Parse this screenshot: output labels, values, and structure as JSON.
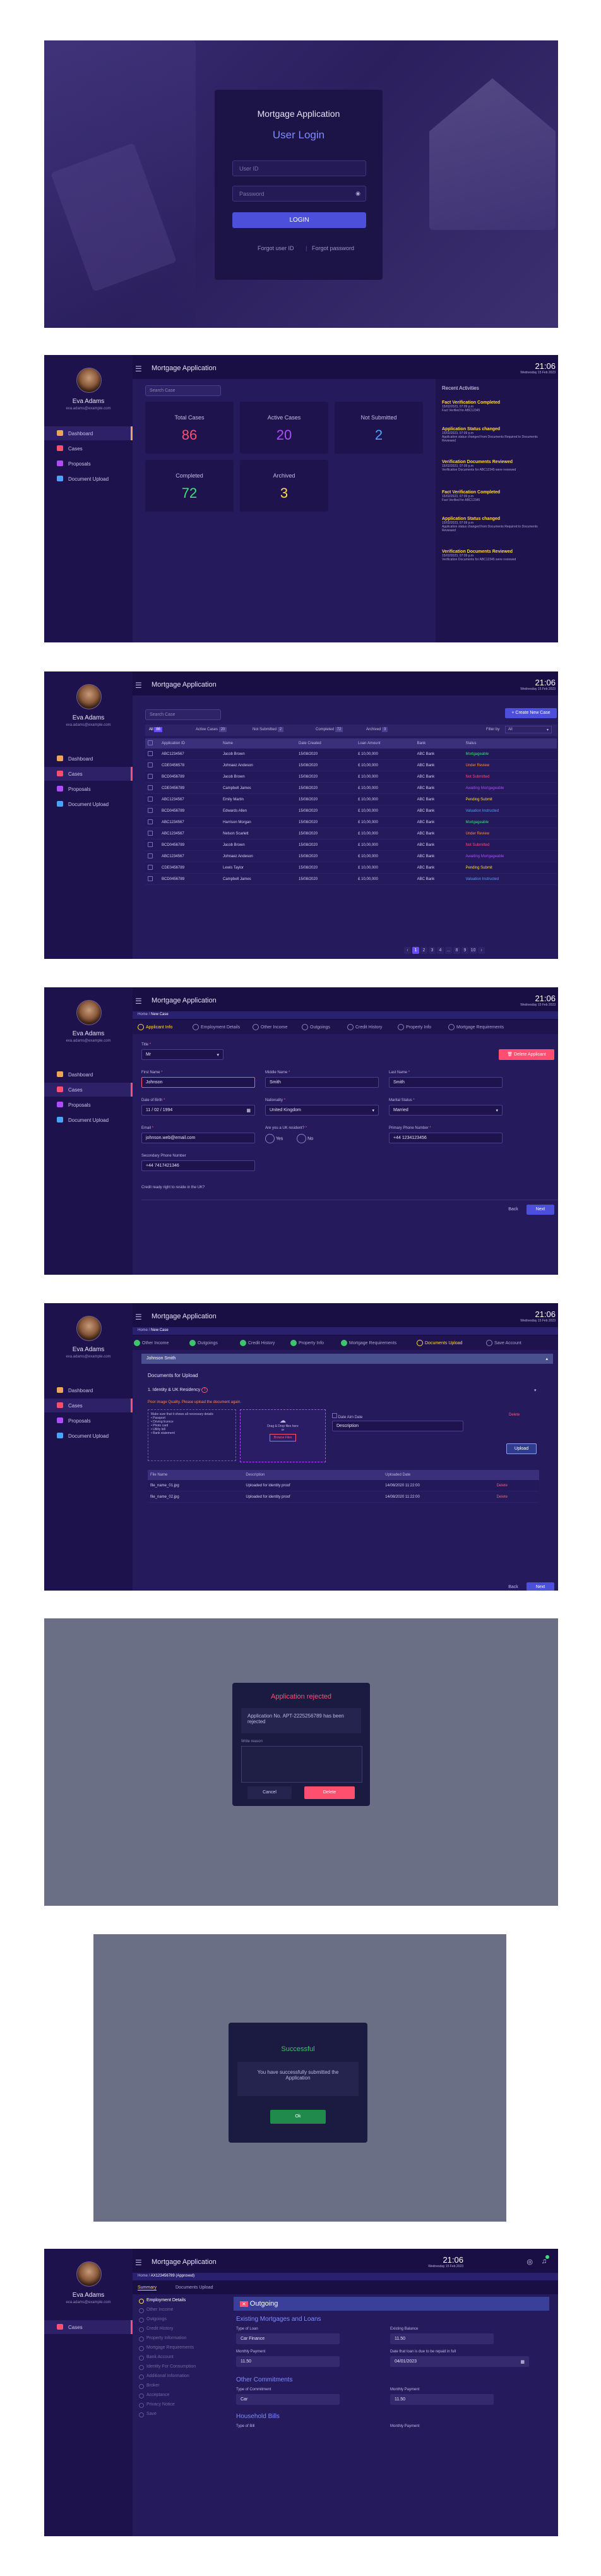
{
  "app_title": "Mortgage Application",
  "login": {
    "heading": "Mortgage Application",
    "subheading": "User Login",
    "user_placeholder": "User ID",
    "password_placeholder": "Password",
    "button": "LOGIN",
    "forgot": "Forgot user ID",
    "forgot_password": "Forgot password"
  },
  "user": {
    "name": "Eva Adams",
    "email": "eva.adams@example.com"
  },
  "clock": {
    "time": "21:06",
    "date": "Wednesday 15 Feb 2023"
  },
  "nav": {
    "dashboard": "Dashboard",
    "cases": "Cases",
    "proposals": "Proposals",
    "document_upload": "Document Upload"
  },
  "dashboard": {
    "search_placeholder": "Search Case",
    "cards": [
      {
        "label": "Total Cases",
        "value": "86",
        "color": "#ff4f6e"
      },
      {
        "label": "Active Cases",
        "value": "20",
        "color": "#b04bff"
      },
      {
        "label": "Not Submitted",
        "value": "2",
        "color": "#4ea2ff"
      },
      {
        "label": "Completed",
        "value": "72",
        "color": "#3ee07a"
      },
      {
        "label": "Archived",
        "value": "3",
        "color": "#ffd94a"
      }
    ],
    "activities_title": "Recent Activities",
    "activities": [
      {
        "title": "Fact Verification Completed",
        "time": "15/02/2023, 07:09 p.m",
        "desc": "Fact Verified for ABC12345"
      },
      {
        "title": "Application Status changed",
        "time": "15/02/2023, 07:09 p.m",
        "desc": "Application status changed from Documents Required to Documents Reviewed"
      },
      {
        "title": "Verification Documents Reviewed",
        "time": "15/02/2023, 07:09 p.m",
        "desc": "Verification Documents for ABC12345 were reviewed"
      },
      {
        "title": "Fact Verification Completed",
        "time": "15/02/2023, 07:09 p.m",
        "desc": "Fact Verified for ABC12345"
      },
      {
        "title": "Application Status changed",
        "time": "15/02/2023, 07:09 p.m",
        "desc": "Application status changed from Documents Required to Documents Reviewed"
      },
      {
        "title": "Verification Documents Reviewed",
        "time": "15/02/2023, 07:09 p.m",
        "desc": "Verification Documents for ABC12345 were reviewed"
      }
    ]
  },
  "cases": {
    "create_button": "+ Create New Case",
    "filter_label": "Filter by",
    "filter_value": "All",
    "tabs": [
      {
        "label": "All",
        "count": "86"
      },
      {
        "label": "Active Cases",
        "count": "20"
      },
      {
        "label": "Not Submitted",
        "count": "2"
      },
      {
        "label": "Completed",
        "count": "72"
      },
      {
        "label": "Archived",
        "count": "3"
      }
    ],
    "columns": [
      "Application ID",
      "Name",
      "Date Created",
      "Loan Amount",
      "Bank",
      "Status"
    ],
    "rows": [
      [
        "ABC1234567",
        "Jacob Brown",
        "15/08/2020",
        "£ 10,00,000",
        "ABC Bank",
        "Mortgageable"
      ],
      [
        "CDE0456578",
        "Johnaez Andeson",
        "15/08/2020",
        "£ 10,00,000",
        "ABC Bank",
        "Under Review"
      ],
      [
        "BCD0456789",
        "Jacob Brown",
        "15/08/2020",
        "£ 10,00,000",
        "ABC Bank",
        "Not Submitted"
      ],
      [
        "CDE0456789",
        "Campbell James",
        "15/08/2020",
        "£ 10,00,000",
        "ABC Bank",
        "Awaiting Mortgageable"
      ],
      [
        "ABC1234567",
        "Emily Martin",
        "15/08/2020",
        "£ 10,00,000",
        "ABC Bank",
        "Pending Submit"
      ],
      [
        "BCD0456789",
        "Edwards Allen",
        "15/08/2020",
        "£ 10,00,000",
        "ABC Bank",
        "Valuation Instructed"
      ],
      [
        "ABC1234567",
        "Harrison Morgan",
        "15/08/2020",
        "£ 10,00,000",
        "ABC Bank",
        "Mortgageable"
      ],
      [
        "ABC1234567",
        "Nelson Scarlett",
        "15/08/2020",
        "£ 10,00,000",
        "ABC Bank",
        "Under Review"
      ],
      [
        "BCD0456789",
        "Jacob Brown",
        "15/08/2020",
        "£ 10,00,000",
        "ABC Bank",
        "Not Submitted"
      ],
      [
        "ABC1234567",
        "Johnaez Andeson",
        "15/08/2020",
        "£ 10,00,000",
        "ABC Bank",
        "Awaiting Mortgageable"
      ],
      [
        "CDE0456789",
        "Lewis Taylor",
        "15/08/2020",
        "£ 10,00,000",
        "ABC Bank",
        "Pending Submit"
      ],
      [
        "BCD0456789",
        "Campbell James",
        "15/08/2020",
        "£ 10,00,000",
        "ABC Bank",
        "Valuation Instructed"
      ]
    ],
    "pages": [
      "1",
      "2",
      "3",
      "4",
      "...",
      "8",
      "9",
      "10"
    ]
  },
  "newcase": {
    "breadcrumb_home": "Home",
    "breadcrumb_current": "New Case",
    "steps": [
      "Applicant Info",
      "Employment Details",
      "Other Income",
      "Outgoings",
      "Credit History",
      "Property Info",
      "Mortgage Requirements"
    ],
    "delete_button": "Delete Applicant",
    "title_label": "Title",
    "title_value": "Mr",
    "first_name_label": "First Name",
    "first_name": "Johnson",
    "middle_name_label": "Middle Name",
    "middle_name": "Smith",
    "last_name_label": "Last Name",
    "last_name": "Smith",
    "dob_label": "Date of Birth",
    "dob": "11 / 02 / 1994",
    "nationality_label": "Nationality",
    "nationality": "United Kingdom",
    "marital_label": "Marital Status",
    "marital": "Married",
    "email_label": "Email",
    "email": "johnson.web@email.com",
    "uk_resident_label": "Are you a UK resident?",
    "yes": "Yes",
    "no": "No",
    "phone_label": "Primary Phone Number",
    "phone": "+44 1234123456",
    "secondary_phone_label": "Secondary Phone Number",
    "secondary_phone": "+44 7417421346",
    "consent": "Credit ready right to reside in the UK?",
    "back": "Back",
    "next": "Next"
  },
  "upload": {
    "breadcrumb_home": "Home",
    "breadcrumb_current": "New Case",
    "steps": [
      "Other Income",
      "Outgoings",
      "Credit History",
      "Property Info",
      "Mortgage Requirements",
      "Documents Upload",
      "Save Account"
    ],
    "applicant": "Johnson Smith",
    "section_title": "Documents for Upload",
    "doc_type": "1. Identity & UK Residency",
    "warning": "Poor image Quality. Please upload the document again.",
    "tips": [
      "Make sure that it shows all necessary details",
      "• Passport",
      "• Driving licence",
      "• Photo card",
      "• Utility bill",
      "• Bank statement"
    ],
    "drop_text": "Drag & Drop files here",
    "drop_or": "or",
    "browse": "Browse Files",
    "date_label": "Date Aim",
    "date_value": "Date",
    "delete": "Delete",
    "description_placeholder": "Description",
    "upload_button": "Upload",
    "table_headers": [
      "File Name",
      "Description",
      "Uploaded Date",
      ""
    ],
    "table_rows": [
      [
        "file_name_01.jpg",
        "Uploaded for identity proof",
        "14/08/2020 11:22:00",
        "Delete"
      ],
      [
        "file_name_02.jpg",
        "Uploaded for identity proof",
        "14/08/2020 11:22:00",
        "Delete"
      ]
    ],
    "back": "Back",
    "next": "Next"
  },
  "reject_modal": {
    "title": "Application rejected",
    "message": "Application No. APT-2225256789 has been rejected",
    "comment_label": "Write reason",
    "cancel": "Cancel",
    "confirm": "Delete"
  },
  "success_modal": {
    "title": "Successful",
    "message": "You have successfully submitted the Application",
    "ok": "Ok"
  },
  "detail": {
    "breadcrumb_home": "Home",
    "breadcrumb_current": "AX123456789 (Approved)",
    "tabs": [
      "Summary",
      "Documents Upload"
    ],
    "sections": [
      "Employment Details",
      "Other Income",
      "Outgoings",
      "Credit History",
      "Property Information",
      "Mortgage Requirements",
      "Bank Account",
      "Identity For Consumption",
      "Additional Information",
      "Broker",
      "Acceptance",
      "Privacy Notice",
      "Save"
    ],
    "card_title": "Outgoing",
    "group1": "Existing Mortgages and Loans",
    "type_of_loan": "Type of Loan",
    "type_value": "Car Finance",
    "outstanding": "Existing Balance",
    "outstanding_value": "11.50",
    "monthly": "Monthly Payment",
    "monthly_value": "11.50",
    "date_label": "Date that loan is due to be repaid in full",
    "date_value": "04/01/2023",
    "group2": "Other Commitments",
    "type_commitment": "Type of Commitment",
    "commitment_value": "Car",
    "monthly2": "Monthly Payment",
    "monthly2_value": "11.50",
    "group3": "Household Bills",
    "bill_type": "Type of Bill",
    "bill_monthly": "Monthly Payment"
  },
  "colors": {
    "accent": "#6a4bff",
    "warning": "#ffd94a",
    "danger": "#ff4f6e",
    "success": "#3ee07a"
  }
}
